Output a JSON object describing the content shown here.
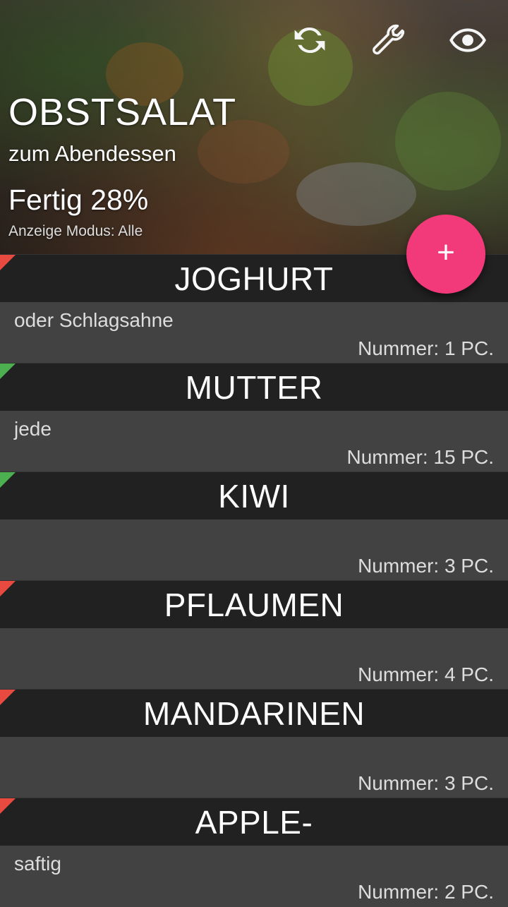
{
  "list_header": {
    "title": "OBSTSALAT",
    "subtitle": "zum Abendessen",
    "progress": "Fertig 28%",
    "mode": "Anzeige Modus: Alle"
  },
  "toolbar": {
    "icons": [
      "refresh-icon",
      "wrench-icon",
      "eye-icon"
    ]
  },
  "fab": {
    "label": "+"
  },
  "colors": {
    "header_bar": "#212121",
    "body_bg": "#424242",
    "fab": "#f23a7a",
    "pending_marker": "#e84a3f",
    "done_marker": "#4caf50"
  },
  "items": [
    {
      "name": "JOGHURT",
      "note": "oder Schlagsahne",
      "qty": "Nummer: 1 PC.",
      "done": false
    },
    {
      "name": "MUTTER",
      "note": "jede",
      "qty": "Nummer: 15 PC.",
      "done": true
    },
    {
      "name": "KIWI",
      "note": "",
      "qty": "Nummer: 3 PC.",
      "done": true
    },
    {
      "name": "PFLAUMEN",
      "note": "",
      "qty": "Nummer: 4 PC.",
      "done": false
    },
    {
      "name": "MANDARINEN",
      "note": "",
      "qty": "Nummer: 3 PC.",
      "done": false
    },
    {
      "name": "APPLE-",
      "note": "saftig",
      "qty": "Nummer: 2 PC.",
      "done": false
    }
  ]
}
